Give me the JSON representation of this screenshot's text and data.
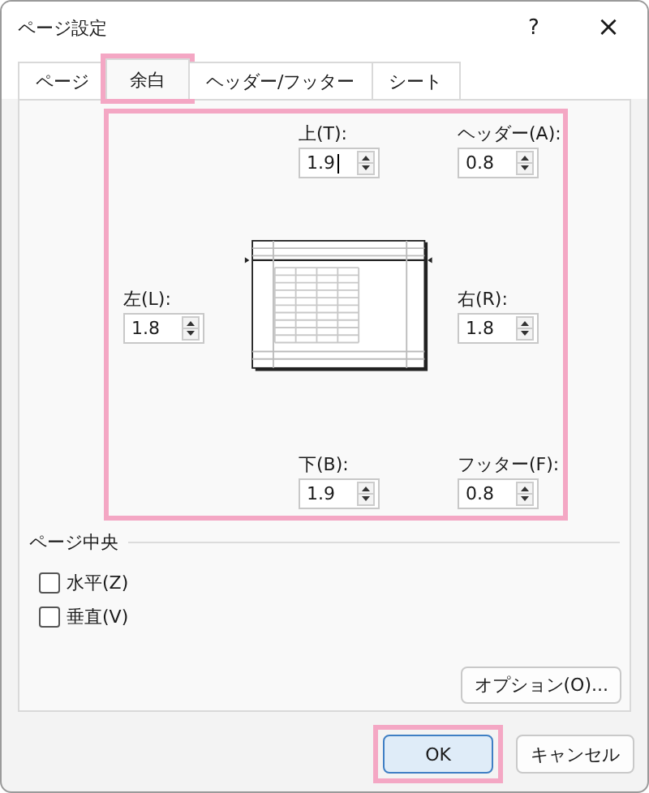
{
  "window": {
    "title": "ページ設定",
    "help": "?",
    "close": "×"
  },
  "tabs": [
    {
      "label": "ページ",
      "selected": false,
      "highlighted": false
    },
    {
      "label": "余白",
      "selected": true,
      "highlighted": true
    },
    {
      "label": "ヘッダー/フッター",
      "selected": false,
      "highlighted": false
    },
    {
      "label": "シート",
      "selected": false,
      "highlighted": false
    }
  ],
  "margins": {
    "highlighted": true,
    "top": {
      "label": "上(T):",
      "value": "1.9",
      "focused": true
    },
    "header": {
      "label": "ヘッダー(A):",
      "value": "0.8",
      "focused": false
    },
    "left": {
      "label": "左(L):",
      "value": "1.8",
      "focused": false
    },
    "right": {
      "label": "右(R):",
      "value": "1.8",
      "focused": false
    },
    "bottom": {
      "label": "下(B):",
      "value": "1.9",
      "focused": false
    },
    "footer": {
      "label": "フッター(F):",
      "value": "0.8",
      "focused": false
    }
  },
  "center_on_page": {
    "title": "ページ中央",
    "options": [
      {
        "label": "水平(Z)",
        "checked": false
      },
      {
        "label": "垂直(V)",
        "checked": false
      }
    ]
  },
  "options_button": "オプション(O)...",
  "buttons": [
    {
      "label": "OK",
      "kind": "primary",
      "highlighted": true
    },
    {
      "label": "キャンセル",
      "kind": "normal",
      "highlighted": false
    }
  ]
}
